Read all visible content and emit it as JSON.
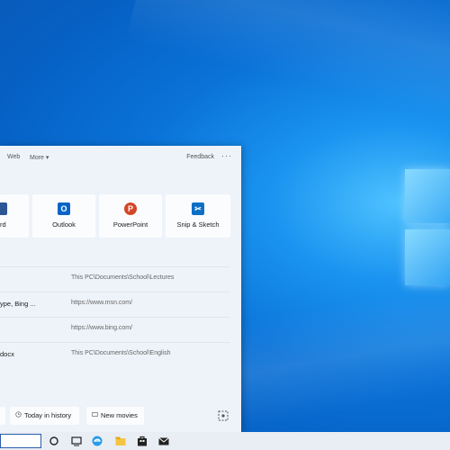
{
  "colors": {
    "desktop_blue": "#0a72d8",
    "panel_bg": "#eef3f9",
    "word_blue": "#2b5797",
    "outlook_blue": "#0a64c8",
    "powerpoint_red": "#d24726",
    "snip_blue": "#0b6fc6"
  },
  "search_panel": {
    "tabs": {
      "web": "Web",
      "more": "More ▾",
      "feedback": "Feedback",
      "options": "···"
    },
    "apps": [
      {
        "name": "rd",
        "icon": "word-icon"
      },
      {
        "name": "Outlook",
        "icon": "outlook-icon"
      },
      {
        "name": "PowerPoint",
        "icon": "powerpoint-icon"
      },
      {
        "name": "Snip & Sketch",
        "icon": "snip-sketch-icon"
      }
    ],
    "recent": [
      {
        "title": "",
        "location": "This PC\\Documents\\School\\Lectures"
      },
      {
        "title": "ype, Bing ...",
        "location": "https://www.msn.com/"
      },
      {
        "title": "",
        "location": "https://www.bing.com/"
      },
      {
        "title": "docx",
        "location": "This PC\\Documents\\School\\English"
      }
    ],
    "quick_searches": [
      {
        "label": "Today in history",
        "icon": "clock-icon"
      },
      {
        "label": "New movies",
        "icon": "movie-icon"
      }
    ],
    "screenshot_icon": "screenshot-icon"
  },
  "taskbar": {
    "search_value": "",
    "icons": [
      "cortana-icon",
      "task-view-icon",
      "edge-icon",
      "file-explorer-icon",
      "store-icon",
      "mail-icon"
    ]
  }
}
